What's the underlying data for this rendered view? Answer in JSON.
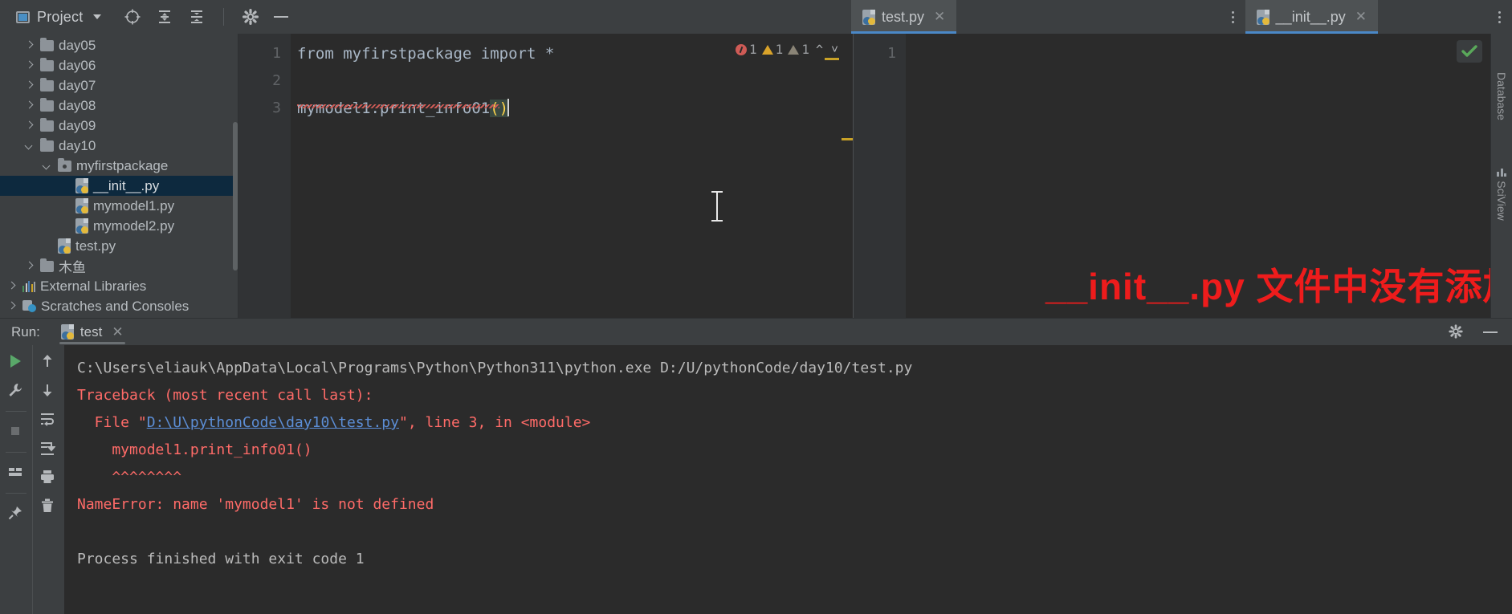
{
  "toolbar": {
    "project_label": "Project",
    "icons": [
      "project-window-icon",
      "chevron-down-icon",
      "locate-icon",
      "expand-all-icon",
      "collapse-all-icon",
      "gear-icon",
      "hide-icon"
    ]
  },
  "tabs": [
    {
      "label": "test.py",
      "icon": "python-file-icon",
      "active": true,
      "closable": true
    },
    {
      "label": "__init__.py",
      "icon": "python-file-icon",
      "active": true,
      "closable": true
    }
  ],
  "tree": {
    "items": [
      {
        "label": "day05",
        "type": "folder",
        "depth": 1,
        "arrow": "closed"
      },
      {
        "label": "day06",
        "type": "folder",
        "depth": 1,
        "arrow": "closed"
      },
      {
        "label": "day07",
        "type": "folder",
        "depth": 1,
        "arrow": "closed"
      },
      {
        "label": "day08",
        "type": "folder",
        "depth": 1,
        "arrow": "closed"
      },
      {
        "label": "day09",
        "type": "folder",
        "depth": 1,
        "arrow": "closed"
      },
      {
        "label": "day10",
        "type": "folder",
        "depth": 1,
        "arrow": "open"
      },
      {
        "label": "myfirstpackage",
        "type": "package",
        "depth": 2,
        "arrow": "open"
      },
      {
        "label": "__init__.py",
        "type": "python",
        "depth": 3,
        "arrow": "none",
        "selected": true
      },
      {
        "label": "mymodel1.py",
        "type": "python",
        "depth": 3,
        "arrow": "none"
      },
      {
        "label": "mymodel2.py",
        "type": "python",
        "depth": 3,
        "arrow": "none"
      },
      {
        "label": "test.py",
        "type": "python",
        "depth": 2,
        "arrow": "none"
      },
      {
        "label": "木鱼",
        "type": "folder",
        "depth": 1,
        "arrow": "closed"
      },
      {
        "label": "External Libraries",
        "type": "library",
        "depth": 0,
        "arrow": "closed"
      },
      {
        "label": "Scratches and Consoles",
        "type": "scratches",
        "depth": 0,
        "arrow": "closed"
      }
    ]
  },
  "editor_left": {
    "line_numbers": [
      "1",
      "2",
      "3"
    ],
    "lines": [
      "from myfirstpackage import *",
      "",
      "mymodel1.print_info01"
    ],
    "highlighted_parens": "()",
    "inspection": {
      "error_count": "1",
      "warning_count": "1",
      "weak_warning_count": "1",
      "up_chevron": "⌃",
      "down_chevron": "⌄"
    }
  },
  "editor_right": {
    "line_numbers": [
      "1"
    ],
    "lines": [
      ""
    ],
    "status": "ok-check"
  },
  "annotation": {
    "text": "__init__.py 文件中没有添加__all__",
    "color": "#ee1c1c"
  },
  "right_strip": {
    "labels": [
      "Database",
      "SciView"
    ]
  },
  "run_panel": {
    "title": "Run:",
    "tab_label": "test",
    "tab_icon": "python-file-icon",
    "header_icons": [
      "gear-icon",
      "hide-icon"
    ],
    "tools_left": [
      "run-icon",
      "wrench-icon",
      "stop-icon",
      "layout-icon",
      "pin-icon"
    ],
    "tools_right": [
      "arrow-up-icon",
      "arrow-down-icon",
      "soft-wrap-icon",
      "scroll-to-end-icon",
      "print-icon",
      "trash-icon"
    ],
    "console_lines": [
      {
        "text": "C:\\Users\\eliauk\\AppData\\Local\\Programs\\Python\\Python311\\python.exe D:/U/pythonCode/day10/test.py",
        "style": "normal"
      },
      {
        "text": "Traceback (most recent call last):",
        "style": "error"
      },
      {
        "prefix": "  File \"",
        "link": "D:\\U\\pythonCode\\day10\\test.py",
        "suffix": "\", line 3, in <module>",
        "style": "error-link"
      },
      {
        "text": "    mymodel1.print_info01()",
        "style": "error"
      },
      {
        "text": "    ^^^^^^^^",
        "style": "error"
      },
      {
        "text": "NameError: name 'mymodel1' is not defined",
        "style": "error"
      },
      {
        "text": "",
        "style": "normal"
      },
      {
        "text": "Process finished with exit code 1",
        "style": "normal"
      }
    ]
  },
  "colors": {
    "accent_blue": "#4a88c7",
    "error_red": "#ff6b68",
    "link_blue": "#5c8ed6",
    "warning_yellow": "#d9a32a",
    "selection_blue": "#0d293e",
    "annotation_red": "#ee1c1c"
  }
}
